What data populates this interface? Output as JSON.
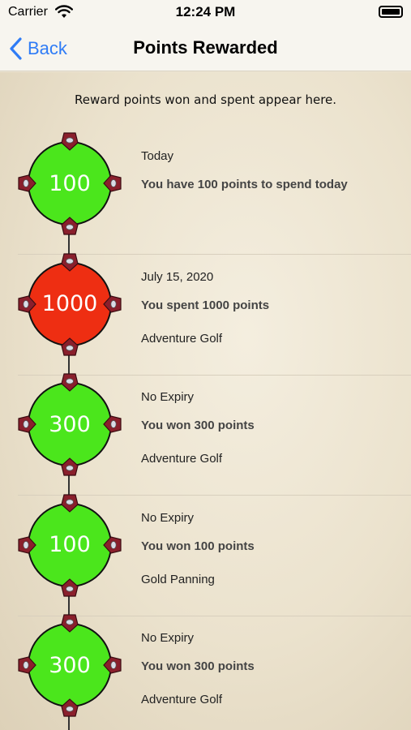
{
  "status_bar": {
    "carrier": "Carrier",
    "time": "12:24 PM"
  },
  "nav": {
    "back_label": "Back",
    "title": "Points Rewarded"
  },
  "subtitle": "Reward points won and spent appear here.",
  "colors": {
    "won": "#4be61c",
    "spent": "#ee2e12",
    "accent": "#2f7cf6",
    "pin": "#8a1f2c"
  },
  "entries": [
    {
      "value": "100",
      "status": "won",
      "date": "Today",
      "description": "You have 100 points to spend today",
      "location": ""
    },
    {
      "value": "1000",
      "status": "spent",
      "date": "July 15, 2020",
      "description": "You spent 1000 points",
      "location": "Adventure Golf"
    },
    {
      "value": "300",
      "status": "won",
      "date": "No Expiry",
      "description": "You won 300 points",
      "location": "Adventure Golf"
    },
    {
      "value": "100",
      "status": "won",
      "date": "No Expiry",
      "description": "You won 100 points",
      "location": "Gold Panning"
    },
    {
      "value": "300",
      "status": "won",
      "date": "No Expiry",
      "description": "You won 300 points",
      "location": "Adventure Golf"
    }
  ]
}
